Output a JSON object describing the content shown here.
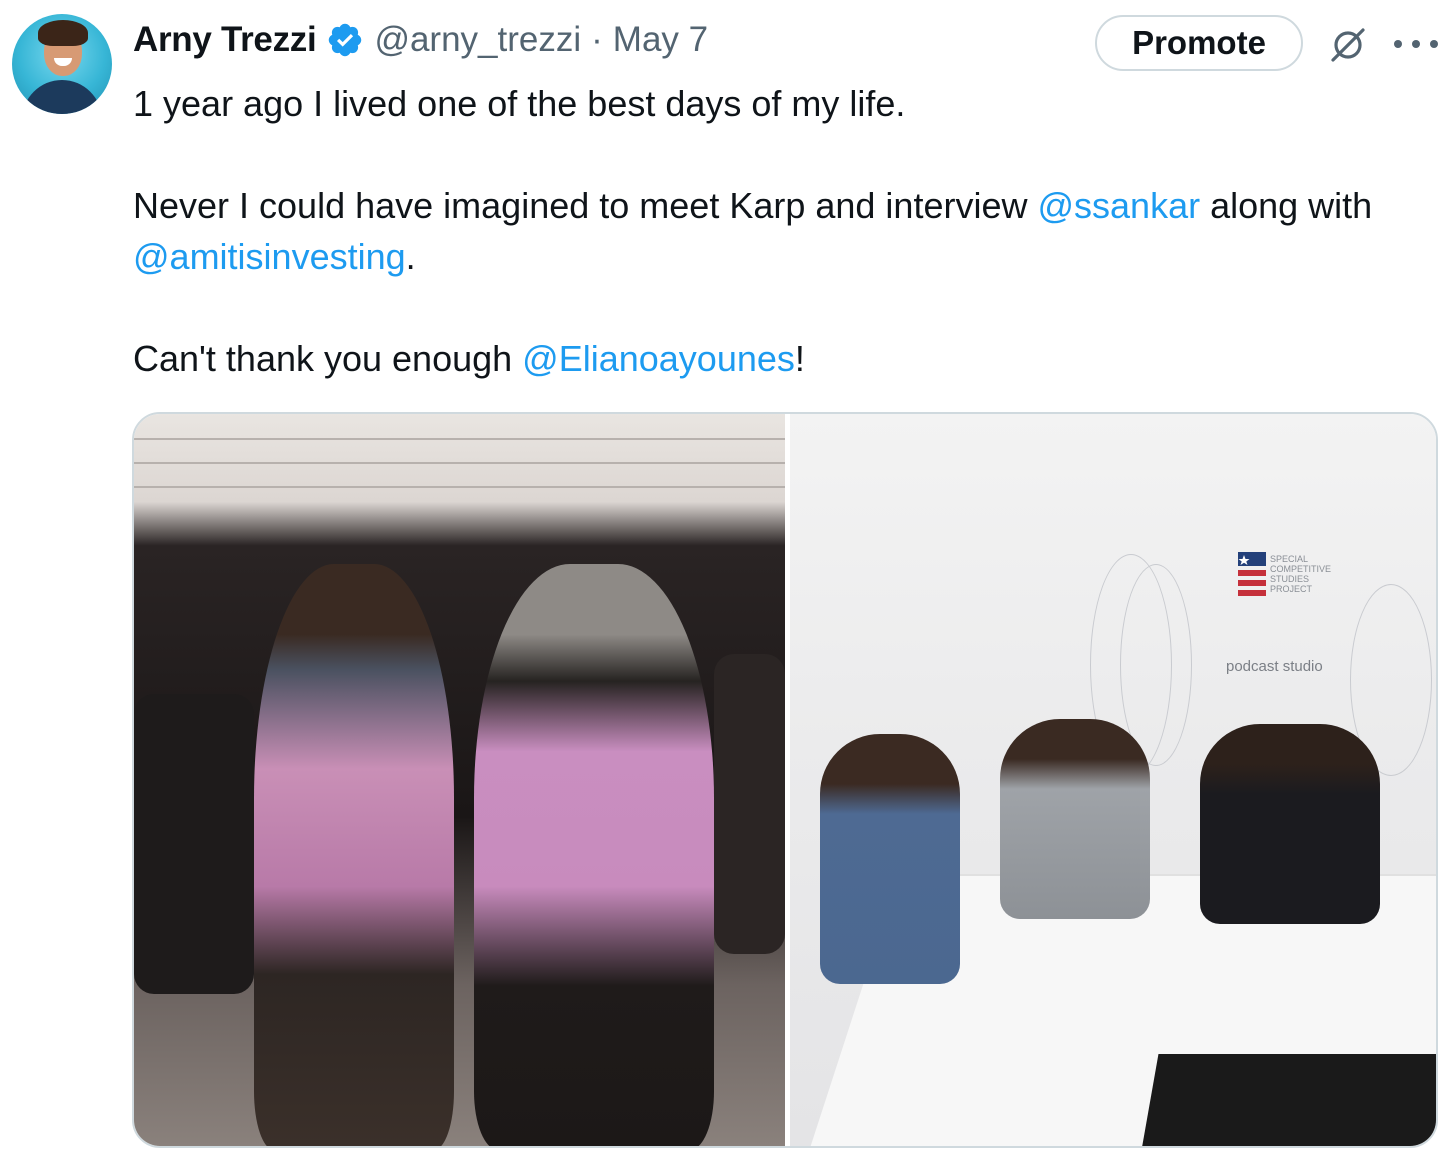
{
  "author": {
    "display_name": "Arny Trezzi",
    "handle": "@arny_trezzi",
    "separator": "·",
    "date": "May 7",
    "verified": true,
    "verified_color": "#1d9bf0"
  },
  "actions": {
    "promote_label": "Promote",
    "grok_icon": "grok-icon",
    "more_icon": "more-icon"
  },
  "body": {
    "line1": "1 year ago I lived one of the best days of my life.",
    "para2_before": "Never I could have imagined to meet Karp and interview ",
    "mention1": "@ssankar",
    "para2_middle": " along with ",
    "mention2": "@amitisinvesting",
    "para2_after": ".",
    "para3_before": "Can't thank you enough ",
    "mention3": "@Elianoayounes",
    "para3_after": "!"
  },
  "media": {
    "right_photo_logo_text": "SPECIAL\nCOMPETITIVE\nSTUDIES\nPROJECT",
    "right_photo_studio_text": "podcast studio"
  },
  "colors": {
    "text_primary": "#0f1419",
    "text_secondary": "#536471",
    "link": "#1d9bf0",
    "border": "#cfd9de"
  }
}
